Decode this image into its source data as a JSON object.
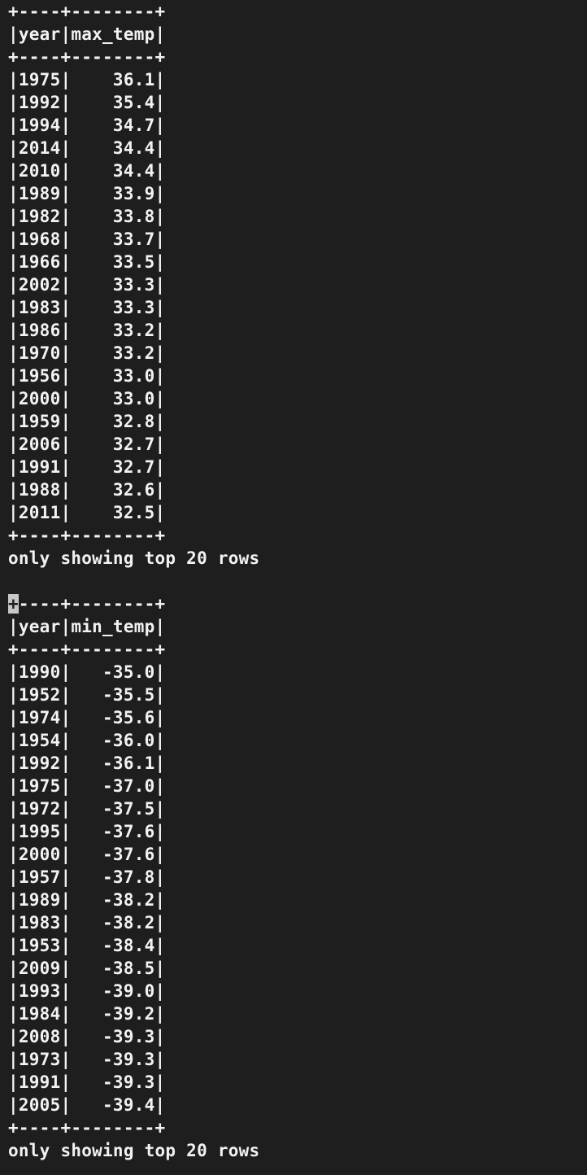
{
  "terminal": {
    "tables": [
      {
        "columns": [
          "year",
          "max_temp"
        ],
        "border": "+----+--------+",
        "header_line": "|year|max_temp|",
        "rows": [
          [
            "1975",
            "36.1"
          ],
          [
            "1992",
            "35.4"
          ],
          [
            "1994",
            "34.7"
          ],
          [
            "2014",
            "34.4"
          ],
          [
            "2010",
            "34.4"
          ],
          [
            "1989",
            "33.9"
          ],
          [
            "1982",
            "33.8"
          ],
          [
            "1968",
            "33.7"
          ],
          [
            "1966",
            "33.5"
          ],
          [
            "2002",
            "33.3"
          ],
          [
            "1983",
            "33.3"
          ],
          [
            "1986",
            "33.2"
          ],
          [
            "1970",
            "33.2"
          ],
          [
            "1956",
            "33.0"
          ],
          [
            "2000",
            "33.0"
          ],
          [
            "1959",
            "32.8"
          ],
          [
            "2006",
            "32.7"
          ],
          [
            "1991",
            "32.7"
          ],
          [
            "1988",
            "32.6"
          ],
          [
            "2011",
            "32.5"
          ]
        ],
        "footer": "only showing top 20 rows"
      },
      {
        "columns": [
          "year",
          "min_temp"
        ],
        "border": "+----+--------+",
        "header_line": "|year|min_temp|",
        "rows": [
          [
            "1990",
            "-35.0"
          ],
          [
            "1952",
            "-35.5"
          ],
          [
            "1974",
            "-35.6"
          ],
          [
            "1954",
            "-36.0"
          ],
          [
            "1992",
            "-36.1"
          ],
          [
            "1975",
            "-37.0"
          ],
          [
            "1972",
            "-37.5"
          ],
          [
            "1995",
            "-37.6"
          ],
          [
            "2000",
            "-37.6"
          ],
          [
            "1957",
            "-37.8"
          ],
          [
            "1989",
            "-38.2"
          ],
          [
            "1983",
            "-38.2"
          ],
          [
            "1953",
            "-38.4"
          ],
          [
            "2009",
            "-38.5"
          ],
          [
            "1993",
            "-39.0"
          ],
          [
            "1984",
            "-39.2"
          ],
          [
            "2008",
            "-39.3"
          ],
          [
            "1973",
            "-39.3"
          ],
          [
            "1991",
            "-39.3"
          ],
          [
            "2005",
            "-39.4"
          ]
        ],
        "footer": "only showing top 20 rows"
      }
    ],
    "colors": {
      "background": "#1e1e1e",
      "text": "#f2f2f2",
      "cursor": "#c8c8c8"
    }
  }
}
